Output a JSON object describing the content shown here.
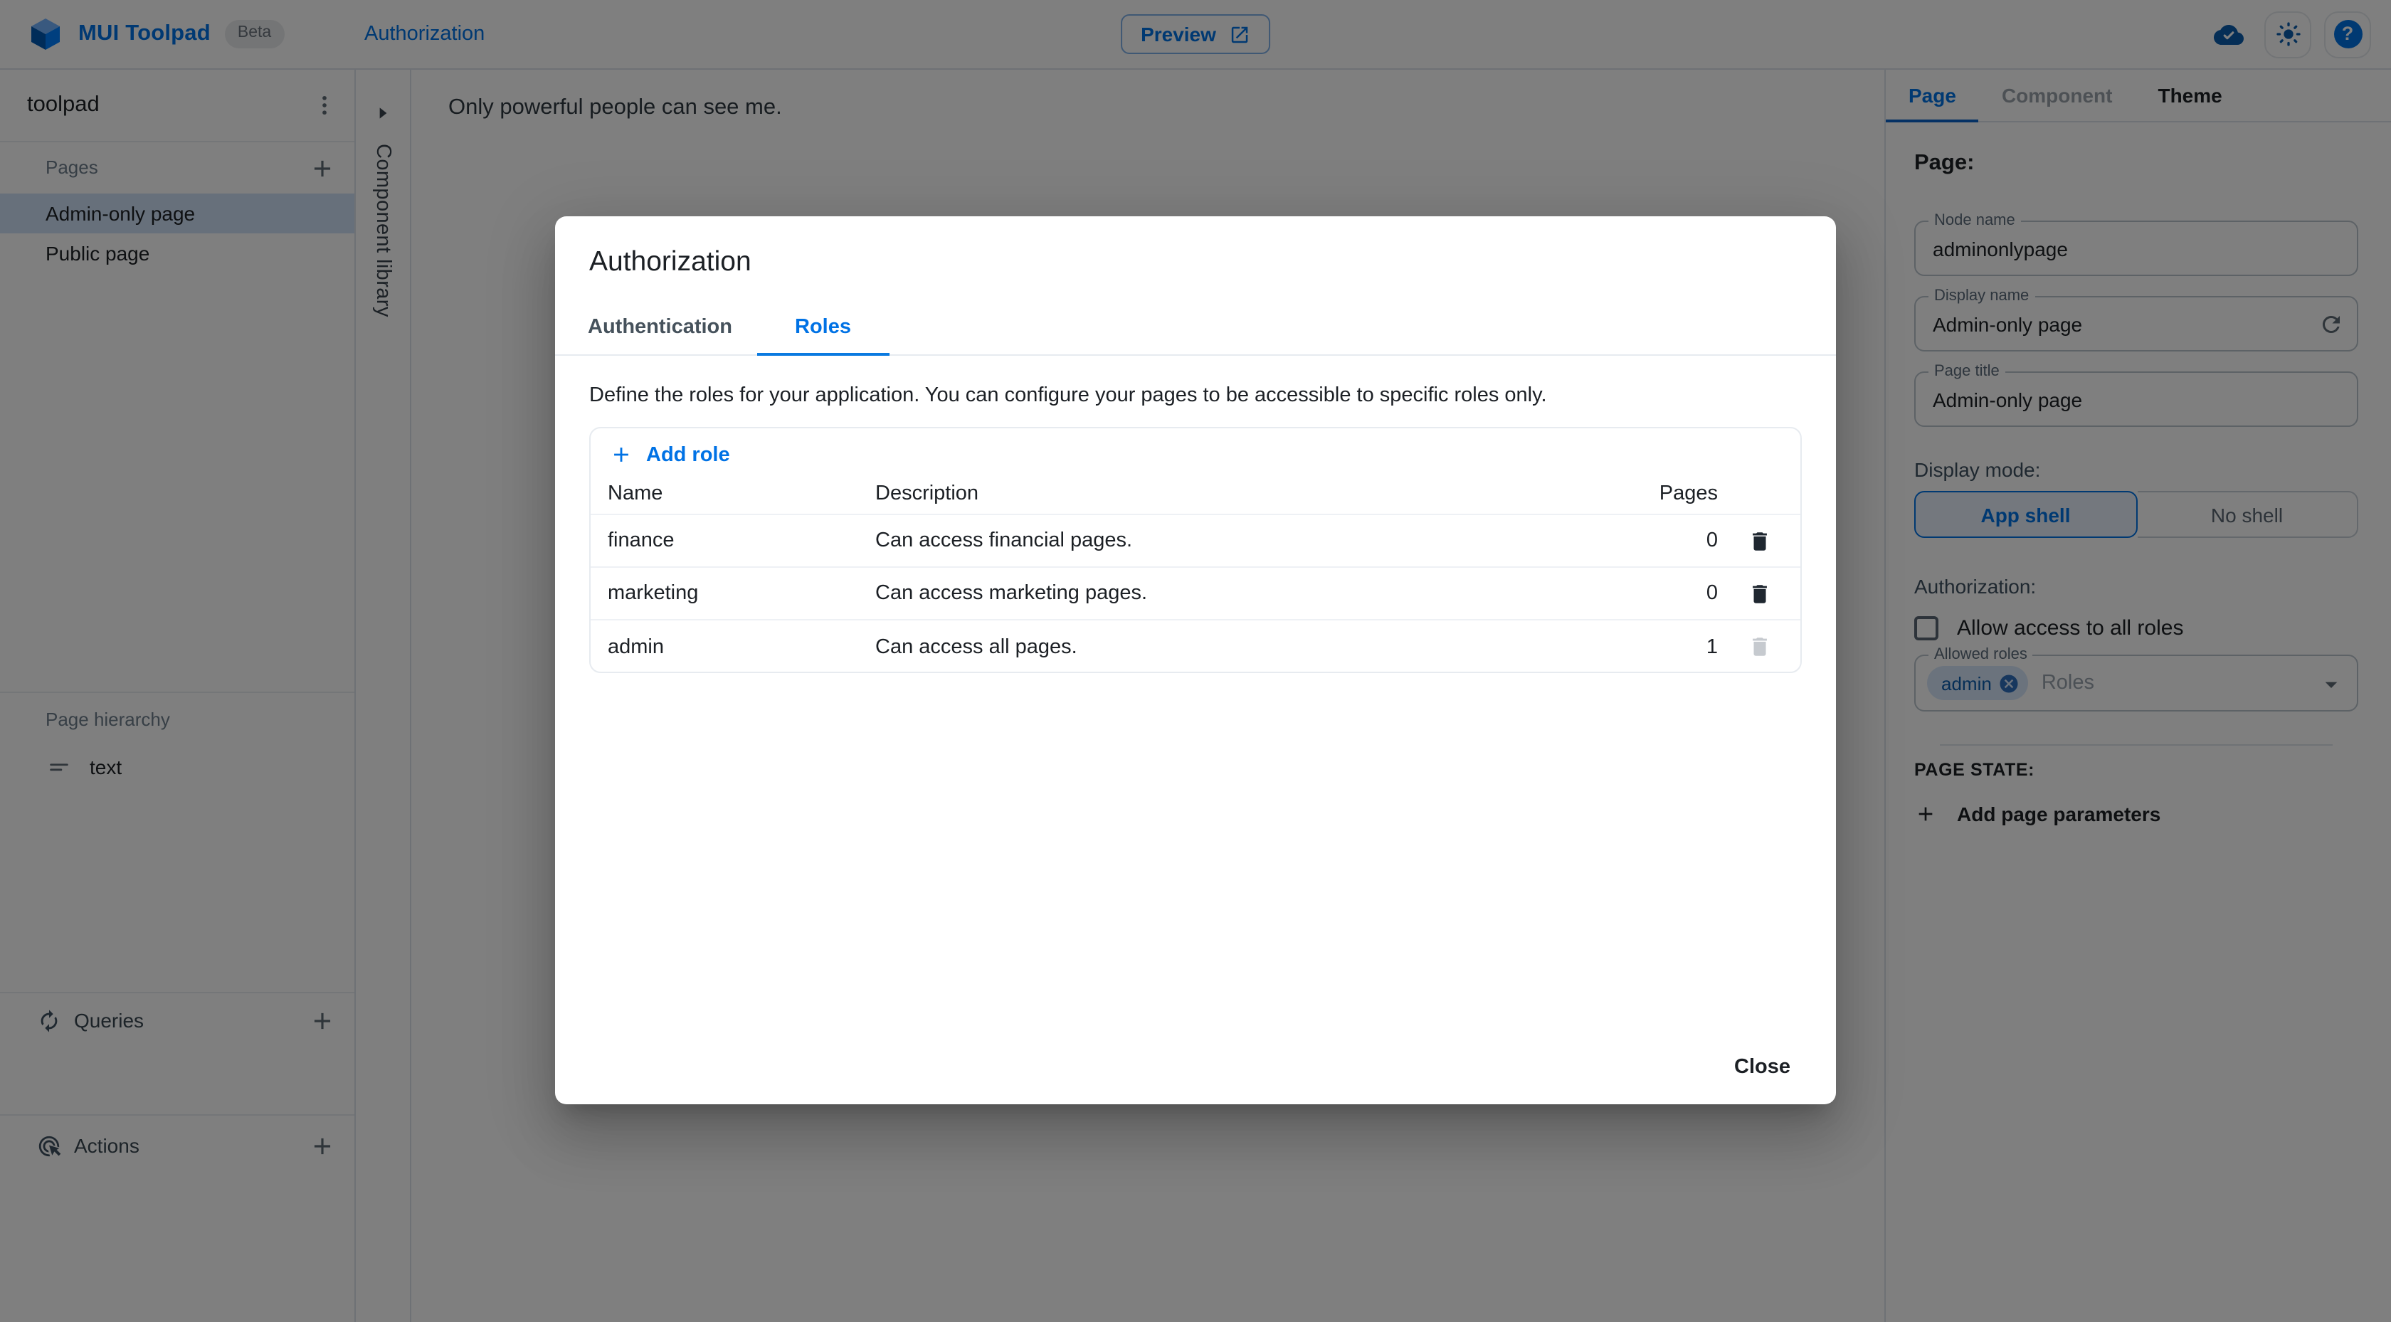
{
  "colors": {
    "primary": "#0072E5",
    "selected_item_bg": "#cfe0f7",
    "backdrop": "rgba(0,0,0,0.5)",
    "chip_bg": "#d7e6fa"
  },
  "icons": {
    "help_glyph": "?"
  },
  "topbar": {
    "app_name": "MUI Toolpad",
    "beta_badge": "Beta",
    "breadcrumb": "Authorization",
    "preview_label": "Preview"
  },
  "sidebar": {
    "project_name": "toolpad",
    "pages_section_label": "Pages",
    "pages": [
      {
        "label": "Admin-only page",
        "selected": true
      },
      {
        "label": "Public page",
        "selected": false
      }
    ],
    "hierarchy_label": "Page hierarchy",
    "hierarchy_items": [
      {
        "label": "text"
      }
    ],
    "queries_label": "Queries",
    "actions_label": "Actions"
  },
  "component_library": {
    "label": "Component library"
  },
  "canvas": {
    "text": "Only powerful people can see me."
  },
  "dialog": {
    "title": "Authorization",
    "tabs": [
      {
        "label": "Authentication",
        "active": false
      },
      {
        "label": "Roles",
        "active": true
      }
    ],
    "description": "Define the roles for your application. You can configure your pages to be accessible to specific roles only.",
    "add_role_label": "Add role",
    "table": {
      "headers": {
        "name": "Name",
        "description": "Description",
        "pages": "Pages"
      },
      "rows": [
        {
          "name": "finance",
          "description": "Can access financial pages.",
          "pages": "0",
          "deletable": true
        },
        {
          "name": "marketing",
          "description": "Can access marketing pages.",
          "pages": "0",
          "deletable": true
        },
        {
          "name": "admin",
          "description": "Can access all pages.",
          "pages": "1",
          "deletable": false
        }
      ]
    },
    "close_label": "Close"
  },
  "inspector": {
    "tabs": [
      {
        "label": "Page",
        "active": true
      },
      {
        "label": "Component",
        "disabled": true
      },
      {
        "label": "Theme",
        "active": false
      }
    ],
    "heading": "Page:",
    "fields": [
      {
        "label": "Node name",
        "value": "adminonlypage"
      },
      {
        "label": "Display name",
        "value": "Admin-only page",
        "has_reset": true
      },
      {
        "label": "Page title",
        "value": "Admin-only page"
      }
    ],
    "display_mode": {
      "label": "Display mode:",
      "options": [
        "App shell",
        "No shell"
      ],
      "selected": "App shell"
    },
    "authorization": {
      "label": "Authorization:",
      "allow_all_label": "Allow access to all roles",
      "allow_all_checked": false,
      "allowed_roles_label": "Allowed roles",
      "role_chips": [
        "admin"
      ],
      "placeholder": "Roles"
    },
    "page_state": {
      "label": "PAGE STATE:",
      "add_parameters_label": "Add page parameters"
    }
  }
}
